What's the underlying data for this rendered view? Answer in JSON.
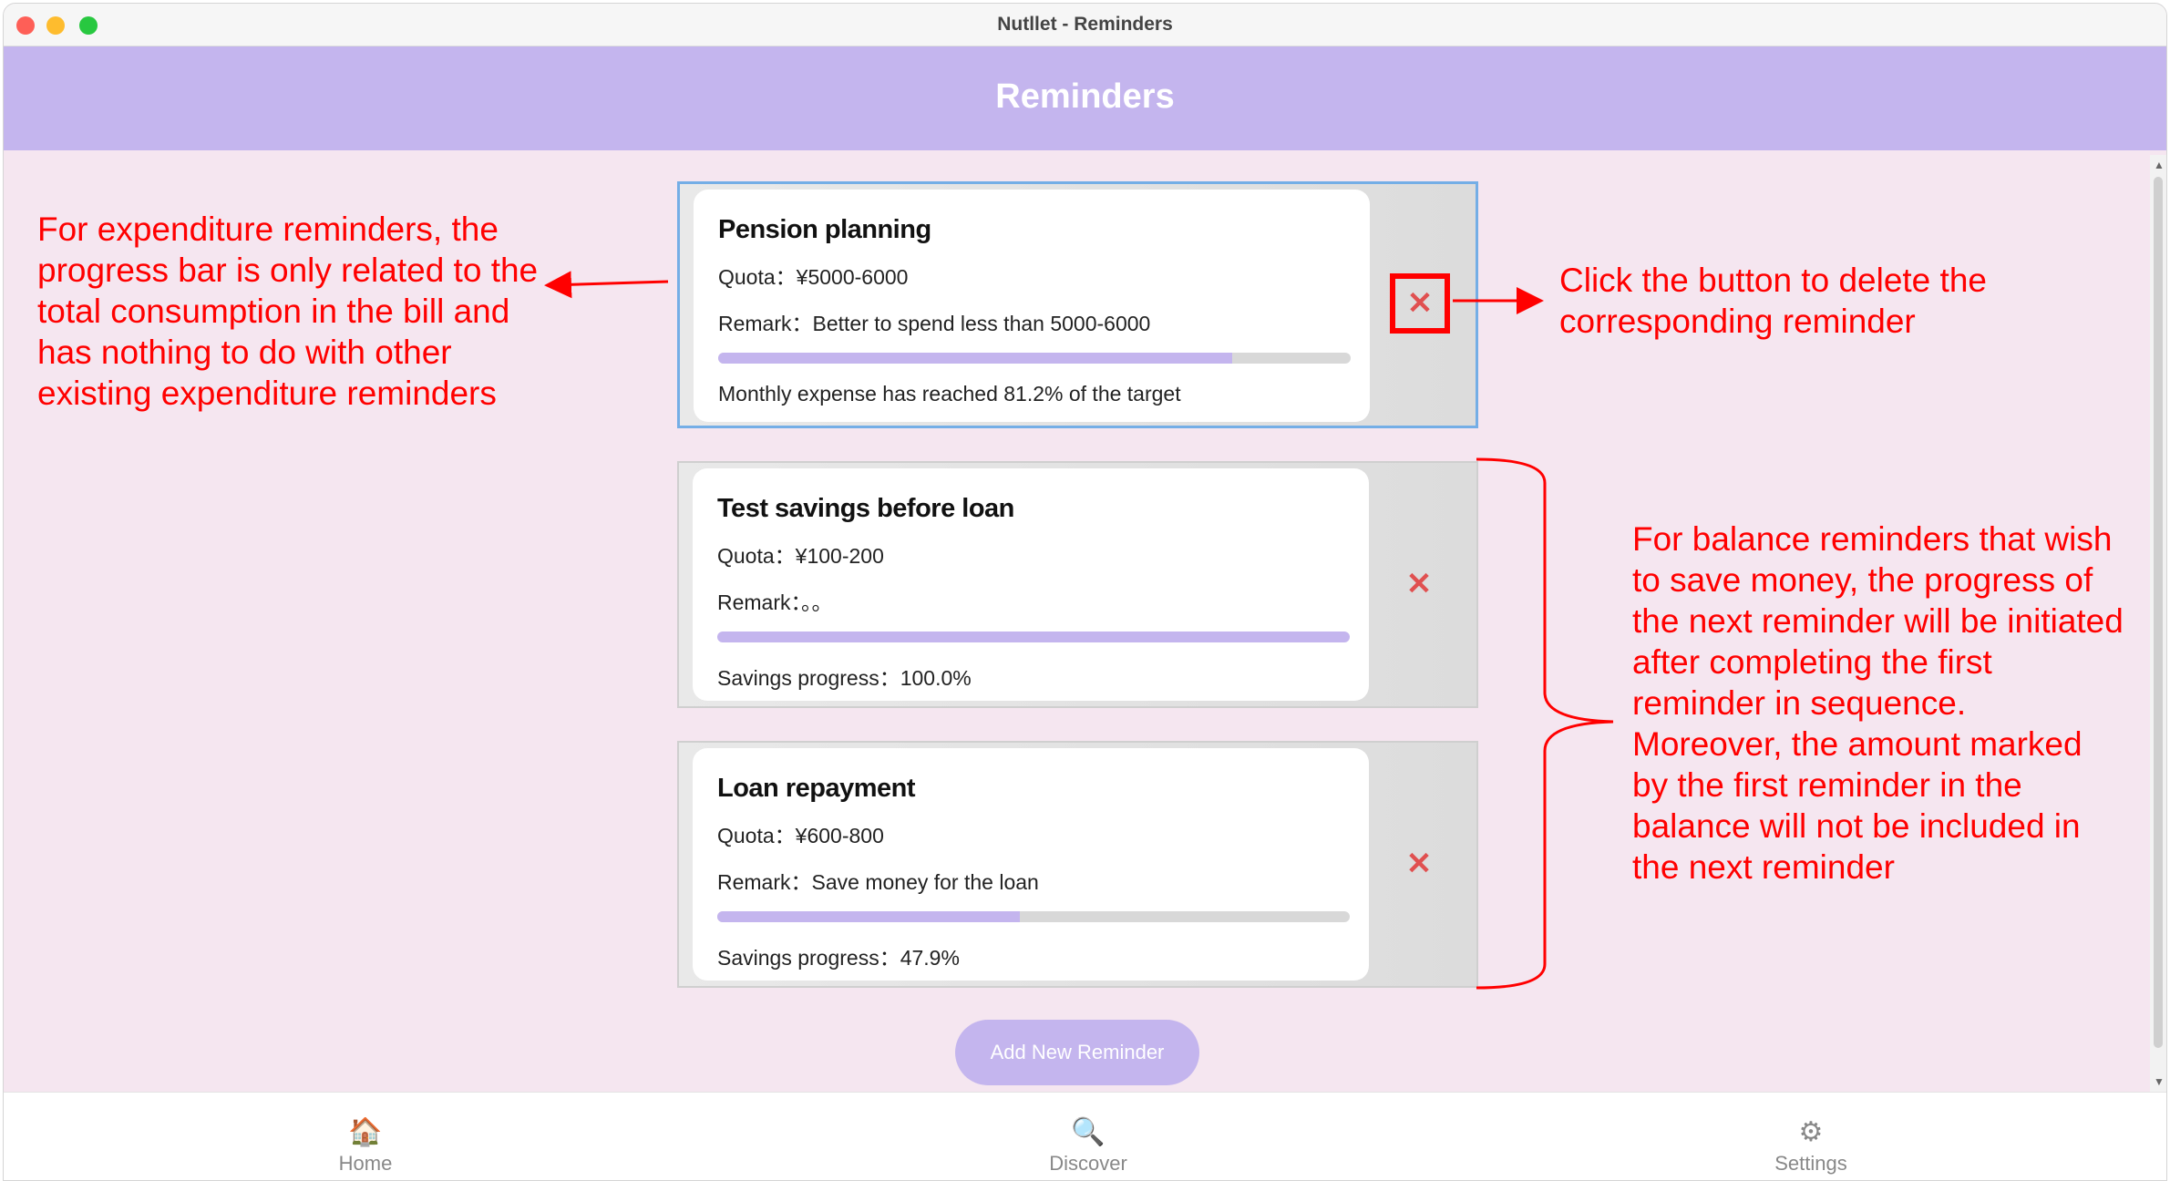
{
  "window": {
    "title": "Nutllet - Reminders"
  },
  "header": {
    "title": "Reminders"
  },
  "reminders": [
    {
      "title": "Pension planning",
      "quota": "Quota：¥5000-6000",
      "remark": "Remark：Better to spend less than 5000-6000",
      "progress": 0.812,
      "status": "Monthly expense has reached 81.2% of the target",
      "delete": "✕"
    },
    {
      "title": "Test savings before loan",
      "quota": "Quota：¥100-200",
      "remark": "Remark：。。",
      "progress": 1.0,
      "status": "Savings progress：100.0%",
      "delete": "✕"
    },
    {
      "title": "Loan repayment",
      "quota": "Quota：¥600-800",
      "remark": "Remark：Save money for the loan",
      "progress": 0.479,
      "status": "Savings progress：47.9%",
      "delete": "✕"
    }
  ],
  "add_button": "Add New Reminder",
  "tabs": [
    {
      "label": "Home",
      "icon": "🏠"
    },
    {
      "label": "Discover",
      "icon": "🔍"
    },
    {
      "label": "Settings",
      "icon": "⚙"
    }
  ],
  "annotations": {
    "left": "For expenditure reminders, the progress bar is only related to the total consumption in the bill and has nothing to do with other existing expenditure reminders",
    "delete": "Click the button to delete the corresponding reminder",
    "right": "For balance reminders that wish to save money, the progress of the next reminder will be initiated after completing the first reminder in sequence. Moreover, the amount marked by the first reminder in the balance will not be included in the next reminder"
  },
  "colors": {
    "accent": "#c4b5ee",
    "background": "#f5e6f0",
    "annotation": "#ff0000",
    "delete": "#e05050"
  }
}
